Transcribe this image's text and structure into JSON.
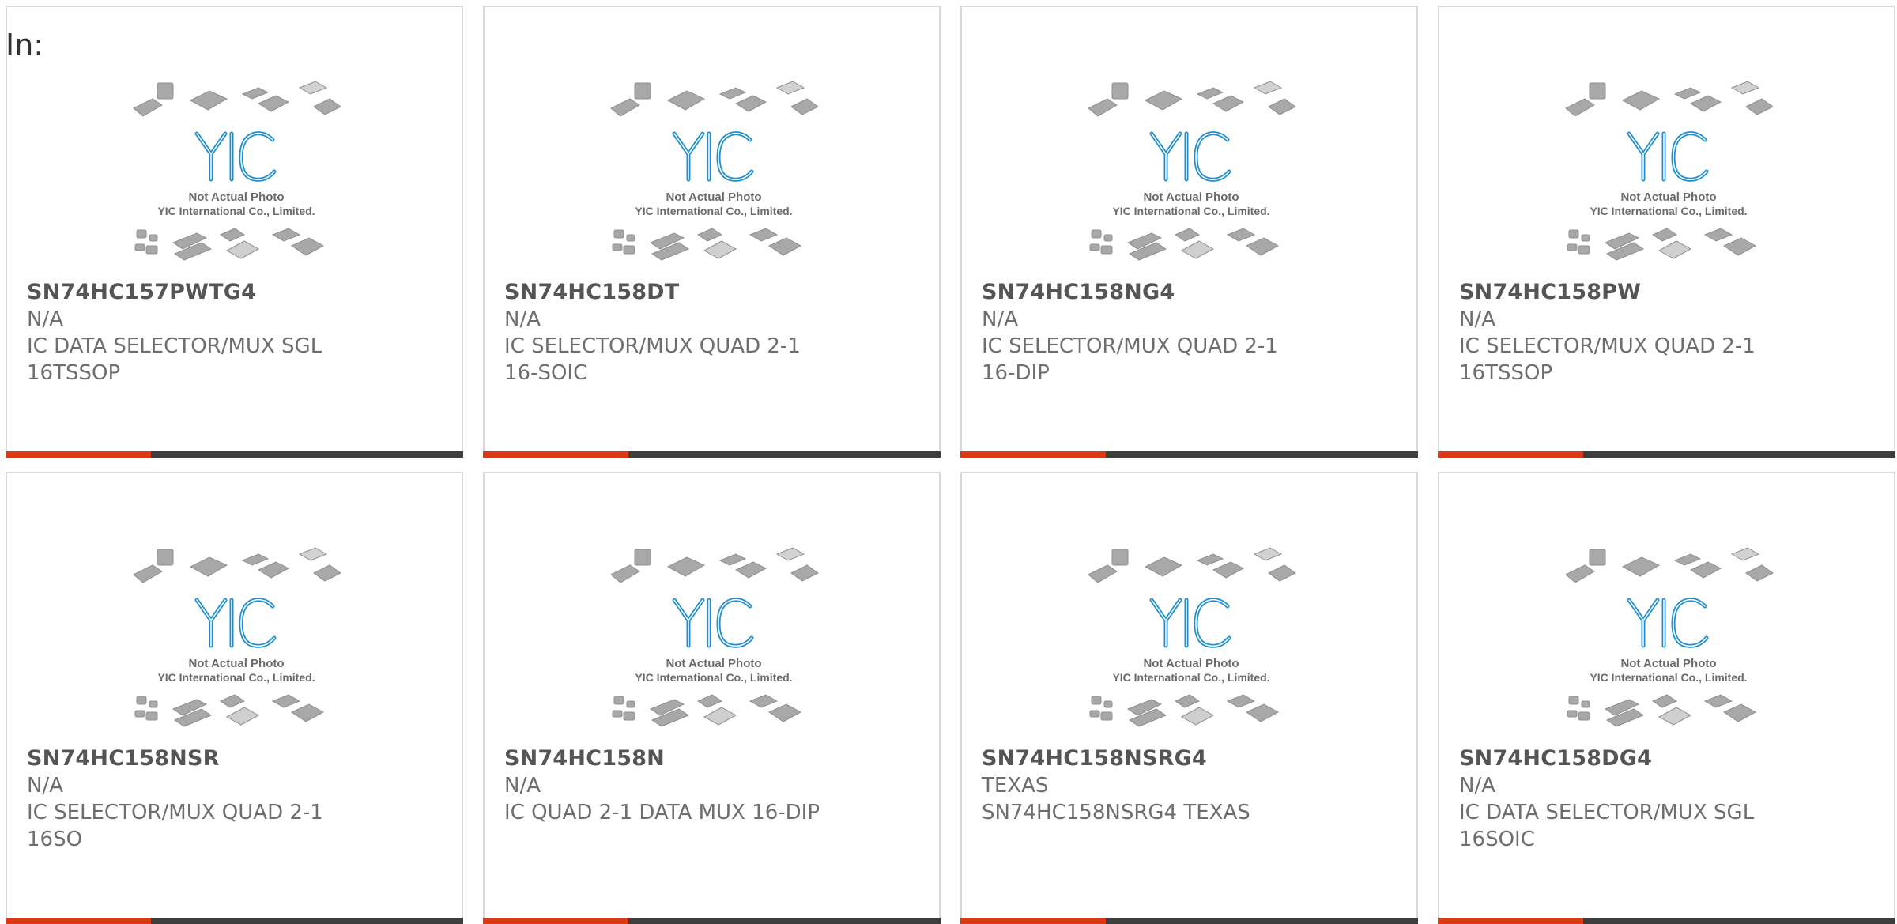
{
  "page_label": "In:",
  "colors": {
    "accent": "#dc3a12",
    "bar_dark": "#3d3d3d",
    "logo_blue": "#1f8fd0",
    "text_gray": "#6e6e6e"
  },
  "placeholder_image": {
    "icon": "chip-package-placeholder-icon",
    "logo_text": "YIC",
    "line1": "Not Actual Photo",
    "line2": "YIC International Co., Limited."
  },
  "products": [
    {
      "part_number": "SN74HC157PWTG4",
      "manufacturer": "N/A",
      "description": "IC DATA SELECTOR/MUX SGL 16TSSOP"
    },
    {
      "part_number": "SN74HC158DT",
      "manufacturer": "N/A",
      "description": "IC SELECTOR/MUX QUAD 2-1 16-SOIC"
    },
    {
      "part_number": "SN74HC158NG4",
      "manufacturer": "N/A",
      "description": "IC SELECTOR/MUX QUAD 2-1 16-DIP"
    },
    {
      "part_number": "SN74HC158PW",
      "manufacturer": "N/A",
      "description": "IC SELECTOR/MUX QUAD 2-1 16TSSOP"
    },
    {
      "part_number": "SN74HC158NSR",
      "manufacturer": "N/A",
      "description": "IC SELECTOR/MUX QUAD 2-1 16SO"
    },
    {
      "part_number": "SN74HC158N",
      "manufacturer": "N/A",
      "description": "IC QUAD 2-1 DATA MUX 16-DIP"
    },
    {
      "part_number": "SN74HC158NSRG4",
      "manufacturer": "TEXAS",
      "description": "SN74HC158NSRG4 TEXAS"
    },
    {
      "part_number": "SN74HC158DG4",
      "manufacturer": "N/A",
      "description": "IC DATA SELECTOR/MUX SGL 16SOIC"
    }
  ]
}
